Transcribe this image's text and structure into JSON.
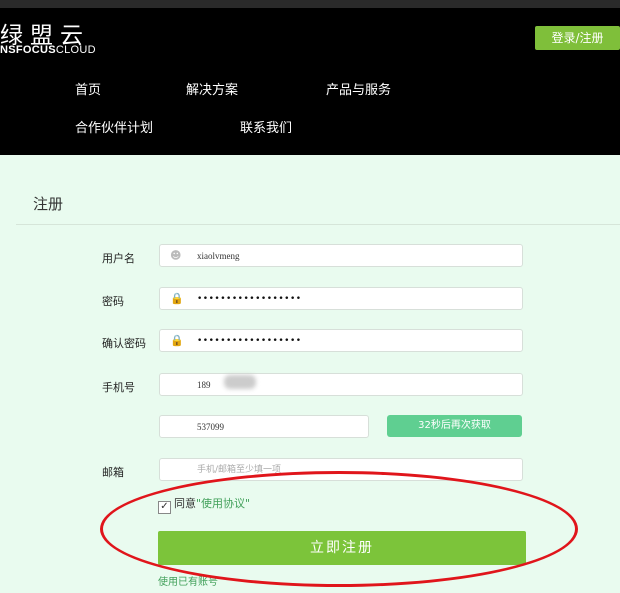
{
  "header": {
    "logo_cn": "绿盟云",
    "logo_en_bold": "NSFOCUS",
    "logo_en_thin": "CLOUD",
    "login_label": "登录/注册",
    "nav": [
      "首页",
      "解决方案",
      "产品与服务",
      "合作伙伴计划",
      "联系我们"
    ]
  },
  "form": {
    "title": "注册",
    "username_label": "用户名",
    "username_value": "xiaolvmeng",
    "password_label": "密码",
    "password_value": "••••••••••••••••••",
    "confirm_label": "确认密码",
    "confirm_value": "••••••••••••••••••",
    "phone_label": "手机号",
    "phone_value": "189",
    "code_value": "537099",
    "sms_button_label": "32秒后再次获取",
    "email_label": "邮箱",
    "email_placeholder": "手机/邮箱至少填一项",
    "agree_prefix": "同意",
    "agree_link": "\"使用协议\"",
    "submit_label": "立即注册",
    "already_label": "使用已有账号"
  },
  "colors": {
    "accent_green": "#7cc43a",
    "sms_green": "#5fcf91",
    "annotation_red": "#e0151b"
  }
}
